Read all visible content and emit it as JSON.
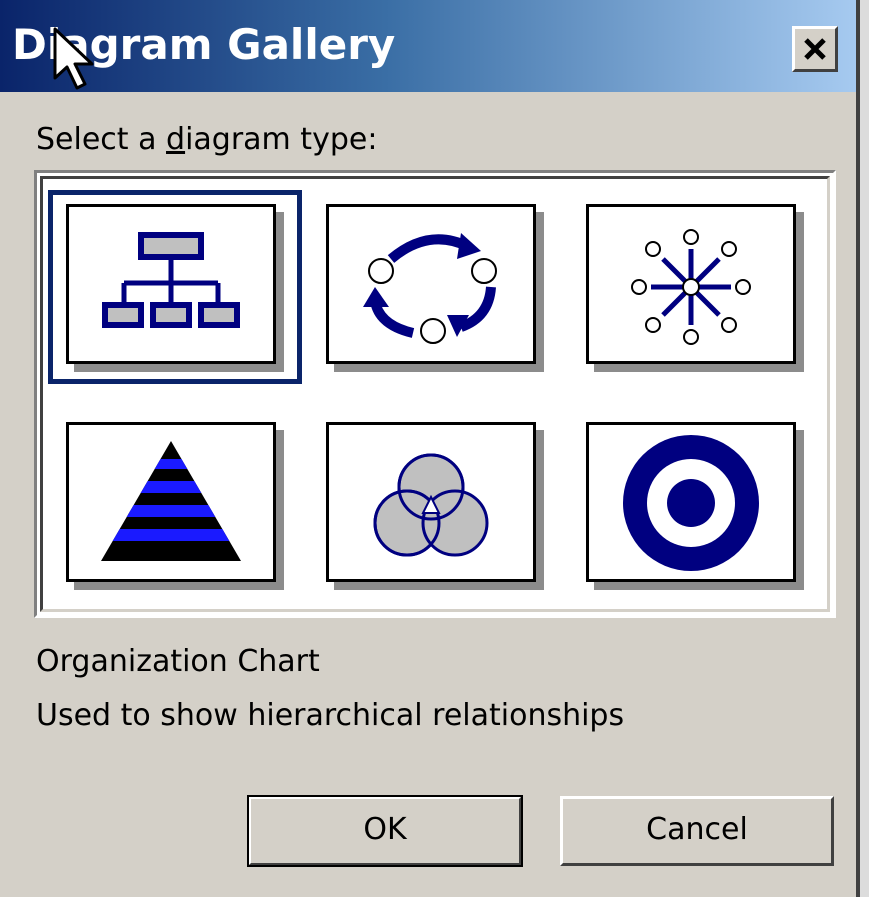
{
  "window": {
    "title": "Diagram Gallery"
  },
  "prompt": {
    "before": "Select a ",
    "accel": "d",
    "after": "iagram type:"
  },
  "diagrams": [
    {
      "id": "organization-chart",
      "icon": "org-chart-icon",
      "selected": true
    },
    {
      "id": "cycle",
      "icon": "cycle-icon",
      "selected": false
    },
    {
      "id": "radial",
      "icon": "radial-icon",
      "selected": false
    },
    {
      "id": "pyramid",
      "icon": "pyramid-icon",
      "selected": false
    },
    {
      "id": "venn",
      "icon": "venn-icon",
      "selected": false
    },
    {
      "id": "target",
      "icon": "target-icon",
      "selected": false
    }
  ],
  "description": {
    "title": "Organization Chart",
    "text": "Used to show hierarchical relationships"
  },
  "buttons": {
    "ok": "OK",
    "cancel": "Cancel"
  },
  "colors": {
    "accent": "#0a246a",
    "icon_blue": "#000080",
    "bright_blue": "#1a1aff",
    "gray": "#c0c0c0"
  }
}
